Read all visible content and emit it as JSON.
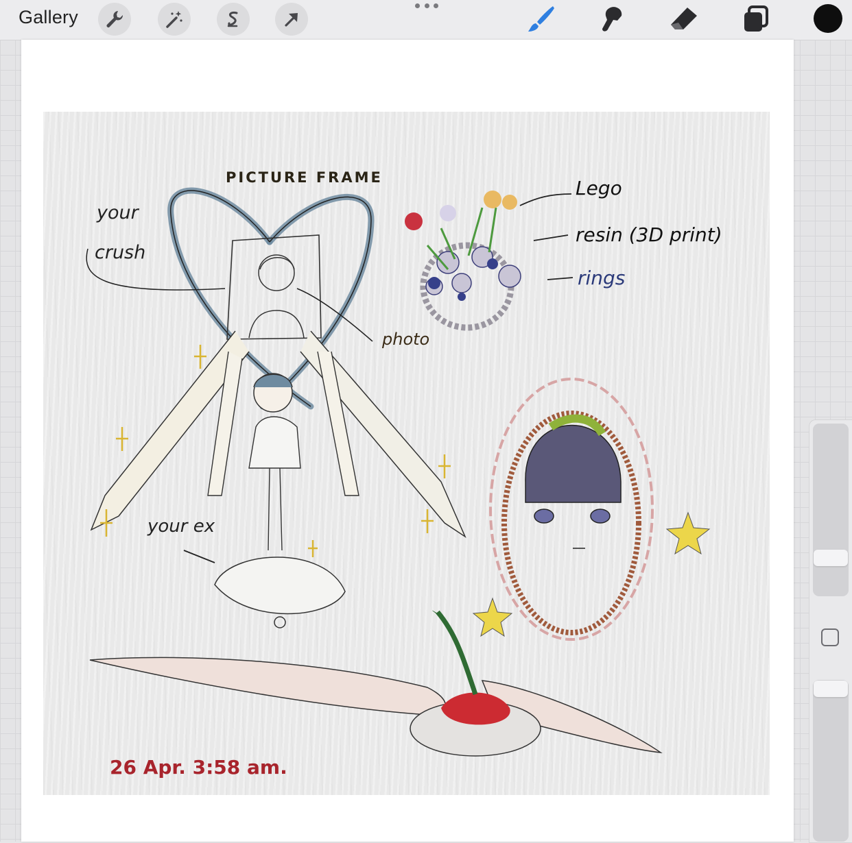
{
  "toolbar": {
    "gallery_label": "Gallery",
    "left_tools": [
      "wrench-icon",
      "magic-wand-icon",
      "selection-icon",
      "transform-arrow-icon"
    ],
    "right_tools": [
      "brush-icon",
      "smudge-icon",
      "eraser-icon",
      "layers-icon"
    ],
    "active_tool": "brush-icon",
    "current_color": "#0e0e0e",
    "accent_color": "#2f7fe0"
  },
  "artwork": {
    "title_label": "PICTURE FRAME",
    "label_your_crush_line1": "your",
    "label_your_crush_line2": "crush",
    "label_photo": "photo",
    "label_lego": "Lego",
    "label_resin": "resin (3D print)",
    "label_rings": "rings",
    "label_your_ex": "your ex",
    "date_signature": "26 Apr. 3:58 am."
  },
  "sidebar": {
    "brush_size_level": 0.85,
    "opacity_level": 0.85
  }
}
